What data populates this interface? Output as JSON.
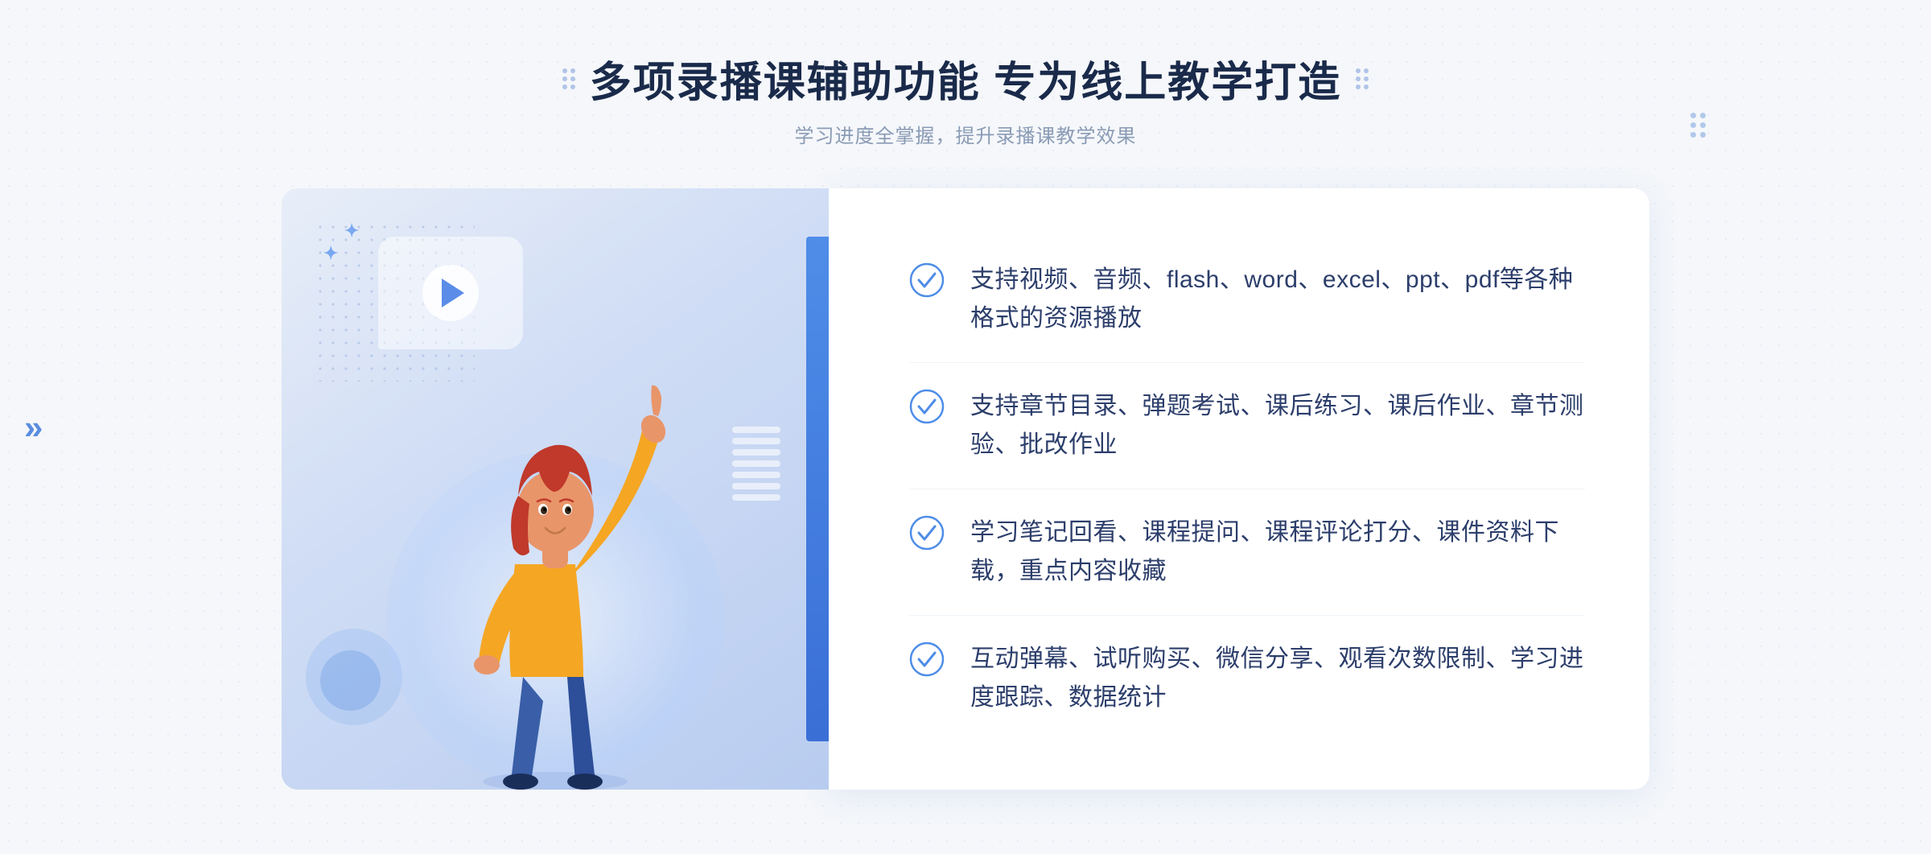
{
  "header": {
    "title": "多项录播课辅助功能 专为线上教学打造",
    "subtitle": "学习进度全掌握，提升录播课教学效果",
    "dots_left": "⁚",
    "dots_right": "⁚"
  },
  "features": [
    {
      "id": 1,
      "text": "支持视频、音频、flash、word、excel、ppt、pdf等各种格式的资源播放"
    },
    {
      "id": 2,
      "text": "支持章节目录、弹题考试、课后练习、课后作业、章节测验、批改作业"
    },
    {
      "id": 3,
      "text": "学习笔记回看、课程提问、课程评论打分、课件资料下载，重点内容收藏"
    },
    {
      "id": 4,
      "text": "互动弹幕、试听购买、微信分享、观看次数限制、学习进度跟踪、数据统计"
    }
  ],
  "outer_deco": {
    "left_arrow": "»",
    "accent_color": "#4e8de8"
  }
}
